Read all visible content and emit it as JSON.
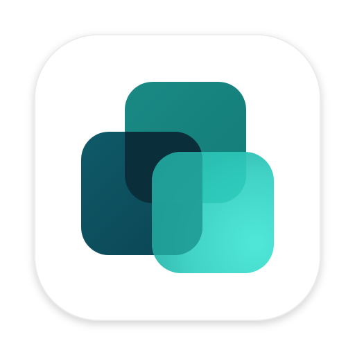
{
  "icon": {
    "name": "overlapping-rounded-squares-app-icon",
    "colors": {
      "background": "#ffffff",
      "tile_border": "#e9e9e9",
      "back_square": "#16837f",
      "left_square": "#0e4f5f",
      "front_square_light": "#3fe3d2",
      "front_square_dark": "#23b5a9",
      "overlap_dark": "#0b2f3a"
    }
  }
}
